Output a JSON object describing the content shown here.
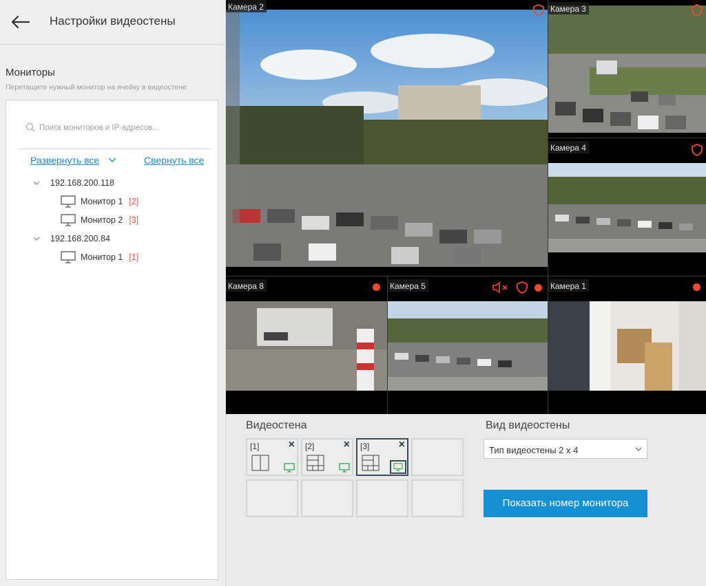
{
  "header": {
    "title": "Настройки видеостены"
  },
  "monitors_section": {
    "title": "Мониторы",
    "hint": "Перетащите нужный монитор на ячейку в видеостене"
  },
  "search": {
    "placeholder": "Поиск мониторов и IP-адресов..."
  },
  "tree_actions": {
    "expand_all": "Развернуть все",
    "collapse_all": "Свернуть все"
  },
  "servers": [
    {
      "ip": "192.168.200.118",
      "monitors": [
        {
          "name": "Монитор 1",
          "num": "[2]"
        },
        {
          "name": "Монитор 2",
          "num": "[3]"
        }
      ]
    },
    {
      "ip": "192.168.200.84",
      "monitors": [
        {
          "name": "Монитор 1",
          "num": "[1]"
        }
      ]
    }
  ],
  "cameras": {
    "cam2": {
      "label": "Камера 2",
      "icons": [
        "shield-icon"
      ]
    },
    "cam3": {
      "label": "Камера 3",
      "icons": [
        "shield-icon"
      ]
    },
    "cam4": {
      "label": "Камера 4",
      "icons": [
        "shield-icon"
      ]
    },
    "cam8": {
      "label": "Камера 8",
      "icons": [
        "record-dot-icon"
      ]
    },
    "cam5": {
      "label": "Камера 5",
      "icons": [
        "speaker-muted-icon",
        "shield-icon",
        "record-dot-icon"
      ]
    },
    "cam1": {
      "label": "Камера 1",
      "icons": [
        "record-dot-icon"
      ]
    }
  },
  "videowall": {
    "label": "Видеостена",
    "cells": [
      {
        "num": "[1]"
      },
      {
        "num": "[2]"
      },
      {
        "num": "[3]",
        "active": true
      }
    ]
  },
  "view": {
    "label": "Вид видеостены",
    "selected": "Тип видеостены 2 х 4"
  },
  "show_button": {
    "label": "Показать номер монитора"
  },
  "colors": {
    "accent": "#1690d1",
    "link": "#1f8ac6",
    "record": "#ef4a2b",
    "monitor_num": "#e25b45",
    "monitor_active": "#2fa84f"
  }
}
